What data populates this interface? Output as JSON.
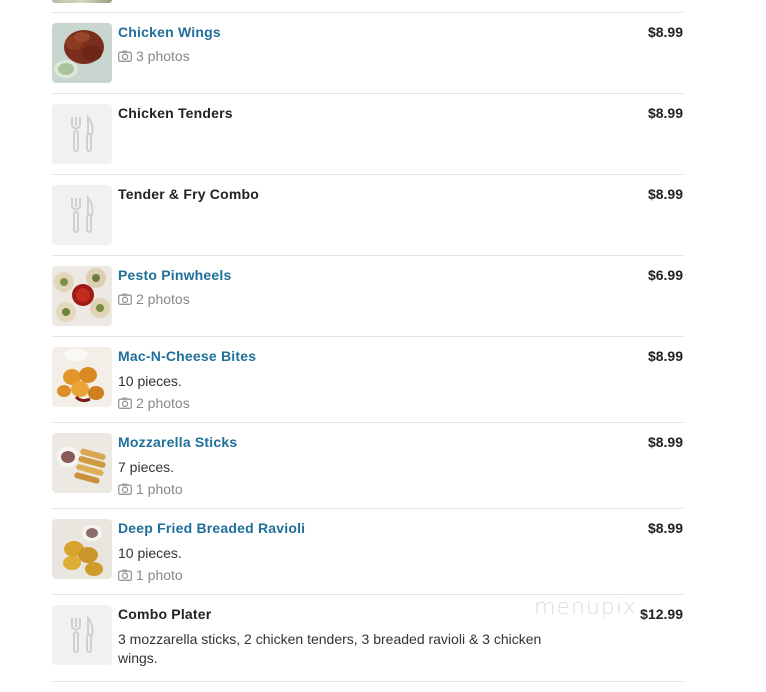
{
  "menu": {
    "items": [
      {
        "name": "Chicken Wings",
        "price": "$8.99",
        "photos": "3 photos",
        "desc": ""
      },
      {
        "name": "Chicken Tenders",
        "price": "$8.99",
        "photos": "",
        "desc": ""
      },
      {
        "name": "Tender & Fry Combo",
        "price": "$8.99",
        "photos": "",
        "desc": ""
      },
      {
        "name": "Pesto Pinwheels",
        "price": "$6.99",
        "photos": "2 photos",
        "desc": ""
      },
      {
        "name": "Mac-N-Cheese Bites",
        "price": "$8.99",
        "photos": "2 photos",
        "desc": "10 pieces."
      },
      {
        "name": "Mozzarella Sticks",
        "price": "$8.99",
        "photos": "1 photo",
        "desc": "7 pieces."
      },
      {
        "name": "Deep Fried Breaded Ravioli",
        "price": "$8.99",
        "photos": "1 photo",
        "desc": "10 pieces."
      },
      {
        "name": "Combo Plater",
        "price": "$12.99",
        "photos": "",
        "desc": "3 mozzarella sticks, 2 chicken tenders, 3 breaded ravioli & 3 chicken wings."
      }
    ]
  },
  "watermark": "menupix",
  "colors": {
    "link": "#1f6f9a",
    "text": "#222222",
    "muted": "#888888",
    "divider": "#e3e3e3"
  },
  "icons": {
    "photo": "camera-icon",
    "placeholder": "fork-knife-icon"
  }
}
